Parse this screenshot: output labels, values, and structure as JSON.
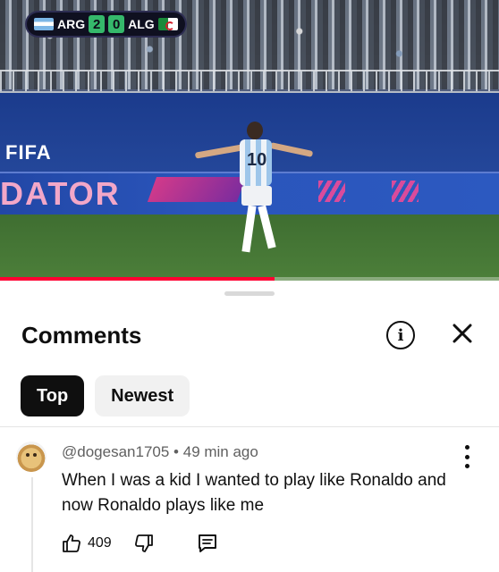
{
  "video": {
    "scoreboard": {
      "home_team": "ARG",
      "home_score": "2",
      "away_score": "0",
      "away_team": "ALG"
    },
    "jersey_number": "10",
    "board_text_fifa": "FIFA",
    "board_text_sponsor": "DATOR",
    "progress_fraction": 0.55,
    "accent_color": "#ff0033"
  },
  "comments_panel": {
    "title": "Comments",
    "info_icon": "info-icon",
    "close_icon": "close-icon",
    "sort_tabs": [
      {
        "label": "Top",
        "active": true
      },
      {
        "label": "Newest",
        "active": false
      }
    ],
    "comments": [
      {
        "author": "@dogesan1705",
        "time": "49 min ago",
        "separator": "•",
        "text": "When I was a kid I wanted to play like Ronaldo and now Ronaldo plays like me",
        "likes": "409",
        "icons": [
          "thumbs-up-icon",
          "thumbs-down-icon",
          "reply-icon",
          "more-vertical-icon"
        ]
      }
    ]
  }
}
